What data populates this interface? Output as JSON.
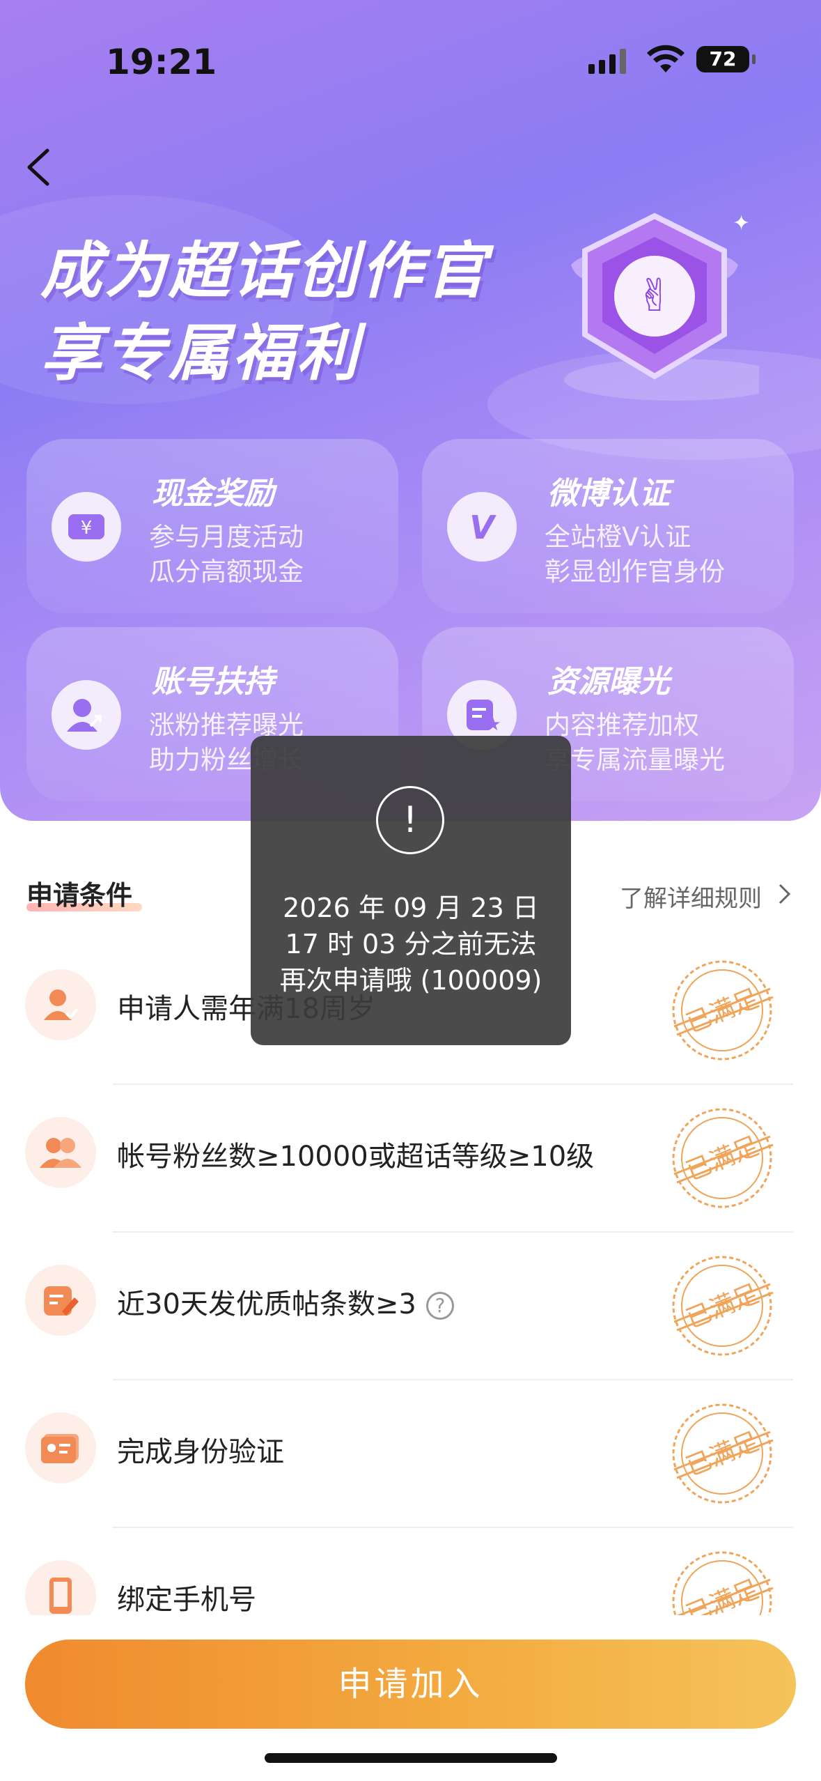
{
  "status_bar": {
    "time": "19:21",
    "battery": "72"
  },
  "hero": {
    "title_line1": "成为超话创作官",
    "title_line2": "享专属福利"
  },
  "benefits": [
    {
      "title": "现金奖励",
      "line1": "参与月度活动",
      "line2": "瓜分高额现金",
      "icon": "cash-ticket-icon"
    },
    {
      "title": "微博认证",
      "line1": "全站橙V认证",
      "line2": "彰显创作官身份",
      "icon": "v-verify-icon"
    },
    {
      "title": "账号扶持",
      "line1": "涨粉推荐曝光",
      "line2": "助力粉丝增长",
      "icon": "user-growth-icon"
    },
    {
      "title": "资源曝光",
      "line1": "内容推荐加权",
      "line2": "享专属流量曝光",
      "icon": "content-star-icon"
    }
  ],
  "conditions": {
    "title": "申请条件",
    "rules_link": "了解详细规则",
    "stamp_text": "已满足",
    "items": [
      {
        "label": "申请人需年满18周岁",
        "icon": "person-check-icon"
      },
      {
        "label": "帐号粉丝数≥10000或超话等级≥10级",
        "icon": "fans-icon"
      },
      {
        "label": "近30天发优质帖条数≥3",
        "icon": "edit-post-icon",
        "help": "?"
      },
      {
        "label": "完成身份验证",
        "icon": "id-card-icon"
      },
      {
        "label": "绑定手机号",
        "icon": "phone-icon"
      }
    ]
  },
  "apply_button": "申请加入",
  "toast": {
    "icon_glyph": "!",
    "line1": "2026 年 09 月 23 日",
    "line2": "17 时 03 分之前无法",
    "line3": "再次申请哦 (100009)"
  },
  "colors": {
    "accent": "#f08a2f",
    "hero_purple": "#8c7cf3",
    "stamp": "#f0a45a"
  }
}
